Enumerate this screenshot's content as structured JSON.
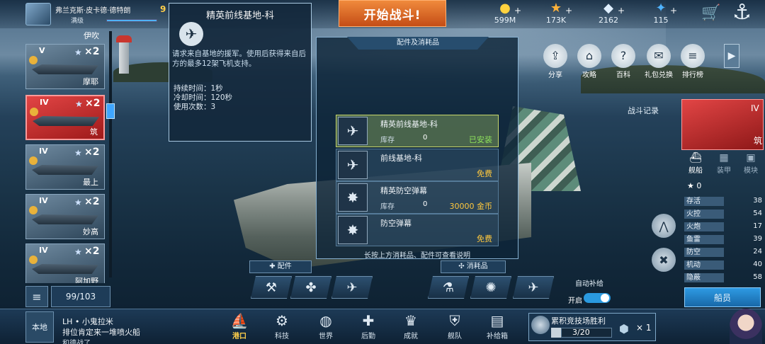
{
  "player": {
    "name": "弗兰克斯·皮卡德·德特朗",
    "rank": "满级",
    "level": "9"
  },
  "start_battle": "开始战斗!",
  "resources": [
    {
      "icon": "gold-coin-icon",
      "glyph": "●",
      "value": "599M"
    },
    {
      "icon": "star-icon",
      "glyph": "★",
      "value": "173K"
    },
    {
      "icon": "diamond-icon",
      "glyph": "◆",
      "value": "2162"
    },
    {
      "icon": "crystal-icon",
      "glyph": "✦",
      "value": "115"
    }
  ],
  "fleet": {
    "top_label": "伊吹",
    "ships": [
      {
        "tier": "V",
        "count": "×2",
        "name": "摩耶"
      },
      {
        "tier": "IV",
        "count": "×2",
        "name": "筑",
        "selected": true
      },
      {
        "tier": "IV",
        "count": "×2",
        "name": "最上"
      },
      {
        "tier": "IV",
        "count": "×2",
        "name": "妙高"
      },
      {
        "tier": "IV",
        "count": "×2",
        "name": "阿加野"
      }
    ],
    "dock_count": "99/103"
  },
  "tooltip": {
    "title": "精英前线基地-科",
    "description": "请求来自基地的援军。使用后获得来自后方的最多12架飞机支持。",
    "duration": "持续时间：1秒",
    "cooldown": "冷却时间：120秒",
    "uses": "使用次数：3"
  },
  "consumables": {
    "header": "配件及消耗品",
    "items": [
      {
        "name": "精英前线基地-科",
        "stock_label": "库存",
        "stock": "0",
        "status": "已安装",
        "status_color": "#8fe35b"
      },
      {
        "name": "前线基地-科",
        "stock_label": "",
        "stock": "",
        "status": "免费",
        "status_color": "#ffc83d"
      },
      {
        "name": "精英防空弹幕",
        "stock_label": "库存",
        "stock": "0",
        "status": "30000 金币",
        "status_color": "#ffc83d"
      },
      {
        "name": "防空弹幕",
        "stock_label": "",
        "stock": "",
        "status": "免费",
        "status_color": "#ffc83d"
      }
    ],
    "hint": "长按上方消耗品、配件可查看说明"
  },
  "slots": {
    "parts_label": "配件",
    "consumables_label": "消耗品",
    "auto_supply_label": "自动补给",
    "auto_supply_state": "开启"
  },
  "quick_menu": [
    {
      "icon": "share-icon",
      "glyph": "⇪",
      "label": "分享"
    },
    {
      "icon": "guide-icon",
      "glyph": "⌂",
      "label": "攻略"
    },
    {
      "icon": "wiki-icon",
      "glyph": "?",
      "label": "百科"
    },
    {
      "icon": "gift-exchange-icon",
      "glyph": "✉",
      "label": "礼包兑换"
    },
    {
      "icon": "ranking-icon",
      "glyph": "≡",
      "label": "排行榜"
    }
  ],
  "battle_log": "战斗记录",
  "ship_panel": {
    "tier": "IV",
    "name": "筑",
    "tabs": [
      {
        "icon": "ship-icon",
        "glyph": "⛴",
        "label": "舰船"
      },
      {
        "icon": "armor-icon",
        "glyph": "▦",
        "label": "装甲"
      },
      {
        "icon": "module-icon",
        "glyph": "▣",
        "label": "模块"
      }
    ],
    "stars": "0",
    "stats": [
      {
        "label": "存活",
        "value": "38"
      },
      {
        "label": "火控",
        "value": "54"
      },
      {
        "label": "火炮",
        "value": "17"
      },
      {
        "label": "鱼雷",
        "value": "39"
      },
      {
        "label": "防空",
        "value": "24"
      },
      {
        "label": "机动",
        "value": "40"
      },
      {
        "label": "隐蔽",
        "value": "58"
      }
    ],
    "crew_button": "船员"
  },
  "chat": {
    "channel": "本地",
    "line1": "LH • 小鬼拉米",
    "line2": "排位肯定来一堆喷火船",
    "line3": "和德战了"
  },
  "nav": [
    {
      "icon": "port-icon",
      "glyph": "⛵",
      "label": "港口",
      "current": true
    },
    {
      "icon": "tech-icon",
      "glyph": "⚙",
      "label": "科技"
    },
    {
      "icon": "world-icon",
      "glyph": "◍",
      "label": "世界"
    },
    {
      "icon": "logistics-icon",
      "glyph": "✚",
      "label": "后勤"
    },
    {
      "icon": "achievement-icon",
      "glyph": "♛",
      "label": "成就"
    },
    {
      "icon": "fleet-icon",
      "glyph": "⛨",
      "label": "舰队"
    },
    {
      "icon": "supply-box-icon",
      "glyph": "▤",
      "label": "补给箱"
    }
  ],
  "arena": {
    "title": "累积竞技场胜利",
    "progress": "3/20",
    "multiplier": "× 1",
    "fraction": 0.15
  }
}
